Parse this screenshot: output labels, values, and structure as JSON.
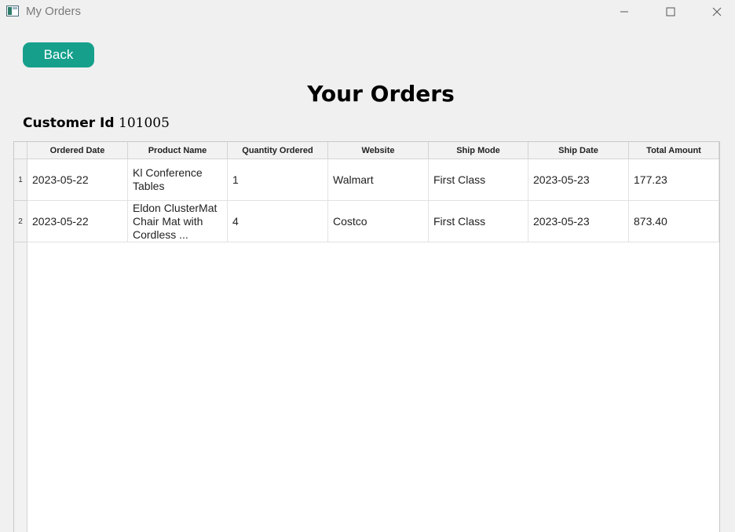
{
  "window": {
    "title": "My Orders",
    "controls": [
      "minimize-icon",
      "maximize-icon",
      "close-icon"
    ]
  },
  "back_button": {
    "label": "Back",
    "color": "#16a08c"
  },
  "page_title": "Your Orders",
  "customer": {
    "label": "Customer Id",
    "value": "101005"
  },
  "table": {
    "columns": [
      "Ordered Date",
      "Product Name",
      "Quantity Ordered",
      "Website",
      "Ship Mode",
      "Ship Date",
      "Total Amount"
    ],
    "rows": [
      {
        "num": "1",
        "cells": [
          "2023-05-22",
          "Kl Conference Tables",
          "1",
          "Walmart",
          "First Class",
          "2023-05-23",
          "177.23"
        ]
      },
      {
        "num": "2",
        "cells": [
          "2023-05-22",
          "Eldon ClusterMat Chair Mat with Cordless ...",
          "4",
          "Costco",
          "First Class",
          "2023-05-23",
          "873.40"
        ]
      }
    ]
  }
}
